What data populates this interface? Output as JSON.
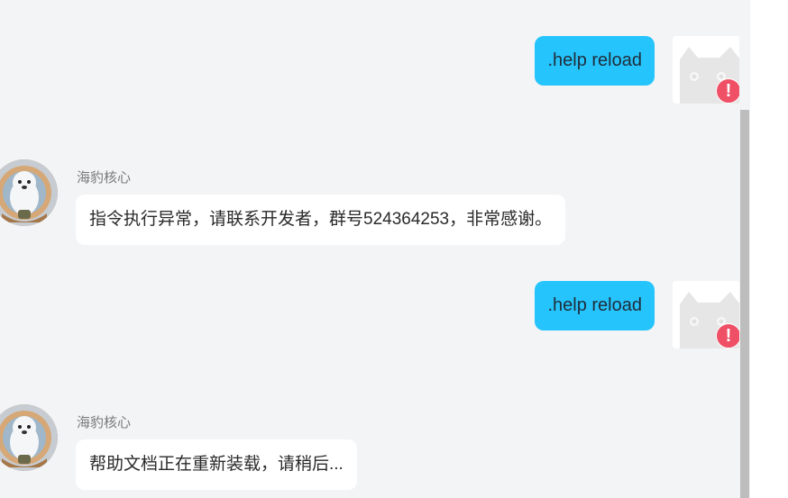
{
  "messages": [
    {
      "direction": "outgoing",
      "text": ".help reload",
      "status": "send-failed",
      "avatar": "cat-placeholder-icon"
    },
    {
      "direction": "incoming",
      "sender": "海豹核心",
      "text": "指令执行异常，请联系开发者，群号524364253，非常感谢。",
      "avatar": "seal-avatar"
    },
    {
      "direction": "outgoing",
      "text": ".help reload",
      "status": "send-failed",
      "avatar": "cat-placeholder-icon"
    },
    {
      "direction": "incoming",
      "sender": "海豹核心",
      "text": "帮助文档正在重新装载，请稍后...",
      "avatar": "seal-avatar"
    }
  ],
  "status_badge": {
    "symbol": "!"
  },
  "colors": {
    "background": "#f3f4f6",
    "outgoing_bubble": "#26c4fc",
    "incoming_bubble": "#ffffff",
    "error_badge": "#ef5065",
    "scrollbar_thumb": "#bdbdbd"
  }
}
